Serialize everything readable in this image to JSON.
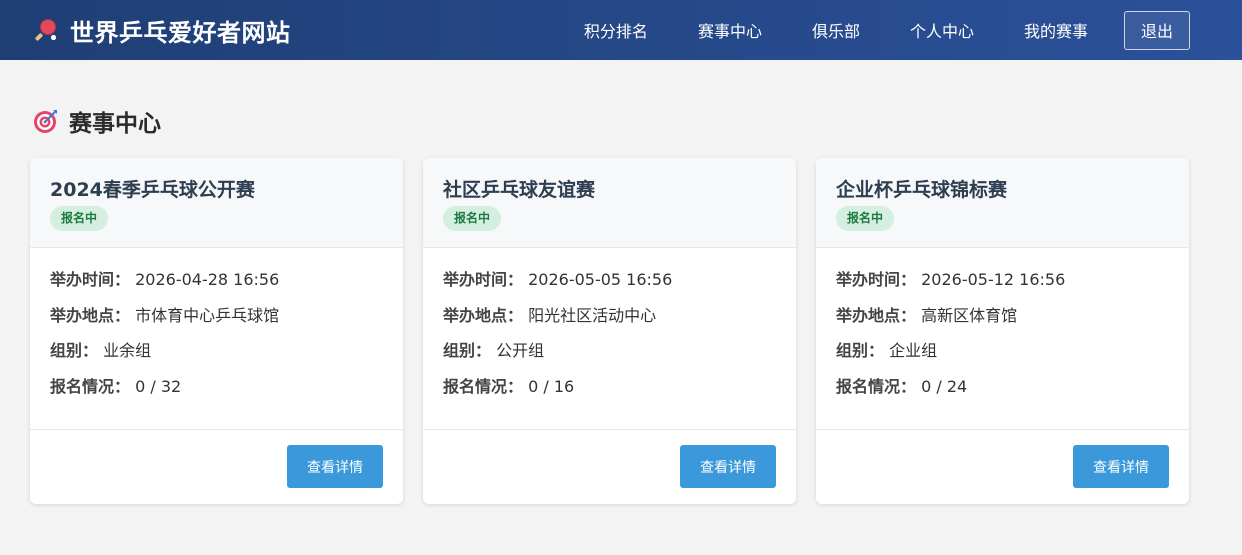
{
  "brand": {
    "title": "世界乒乓爱好者网站",
    "icon": "ping-pong-paddle-icon"
  },
  "nav": {
    "items": [
      {
        "label": "积分排名"
      },
      {
        "label": "赛事中心"
      },
      {
        "label": "俱乐部"
      },
      {
        "label": "个人中心"
      },
      {
        "label": "我的赛事"
      }
    ],
    "logout_label": "退出"
  },
  "section": {
    "title": "赛事中心",
    "icon": "target-icon"
  },
  "labels": {
    "time": "举办时间：",
    "location": "举办地点：",
    "group": "组别：",
    "signup": "报名情况："
  },
  "events": [
    {
      "title": "2024春季乒乓球公开赛",
      "status": "报名中",
      "time": "2026-04-28 16:56",
      "location": "市体育中心乒乓球馆",
      "group": "业余组",
      "signup": "0 / 32",
      "button": "查看详情"
    },
    {
      "title": "社区乒乓球友谊赛",
      "status": "报名中",
      "time": "2026-05-05 16:56",
      "location": "阳光社区活动中心",
      "group": "公开组",
      "signup": "0 / 16",
      "button": "查看详情"
    },
    {
      "title": "企业杯乒乓球锦标赛",
      "status": "报名中",
      "time": "2026-05-12 16:56",
      "location": "高新区体育馆",
      "group": "企业组",
      "signup": "0 / 24",
      "button": "查看详情"
    }
  ],
  "colors": {
    "nav_bg_start": "#1f3e74",
    "nav_bg_end": "#2b519a",
    "badge_bg": "#d4efdf",
    "badge_text": "#1e7a43",
    "button_bg": "#3a98db",
    "page_bg": "#f3f3f4"
  }
}
